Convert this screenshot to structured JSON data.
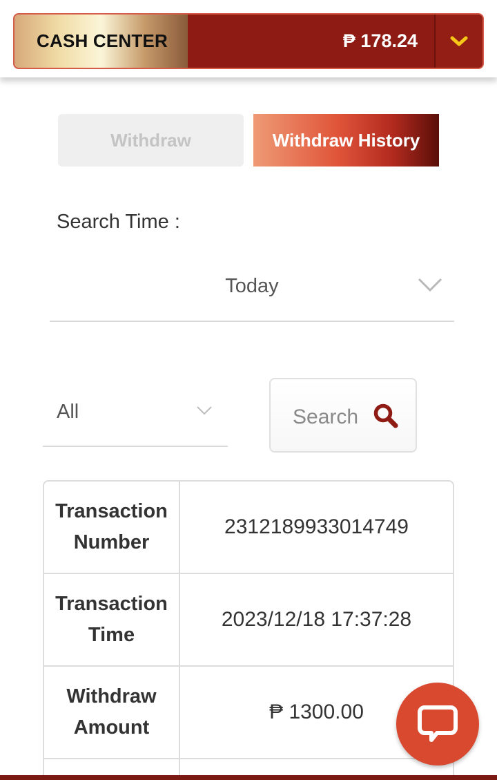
{
  "header": {
    "cash_center_label": "CASH CENTER",
    "balance": "₱ 178.24",
    "dropdown_icon": "chevron-down-icon",
    "accent_color": "#8e1c14",
    "chevron_color": "#f5c518"
  },
  "tabs": [
    {
      "label": "Withdraw",
      "active": false
    },
    {
      "label": "Withdraw History",
      "active": true
    }
  ],
  "filters": {
    "search_time_label": "Search Time :",
    "time_range_value": "Today",
    "status_value": "All",
    "search_button_label": "Search",
    "search_icon": "search-icon"
  },
  "transaction": {
    "rows": [
      {
        "label": "Transaction Number",
        "value": "2312189933014749"
      },
      {
        "label": "Transaction Time",
        "value": "2023/12/18 17:37:28"
      },
      {
        "label": "Withdraw Amount",
        "value": "₱ 1300.00"
      }
    ]
  },
  "chat": {
    "icon": "chat-bubble-icon",
    "color": "#d9492f"
  }
}
